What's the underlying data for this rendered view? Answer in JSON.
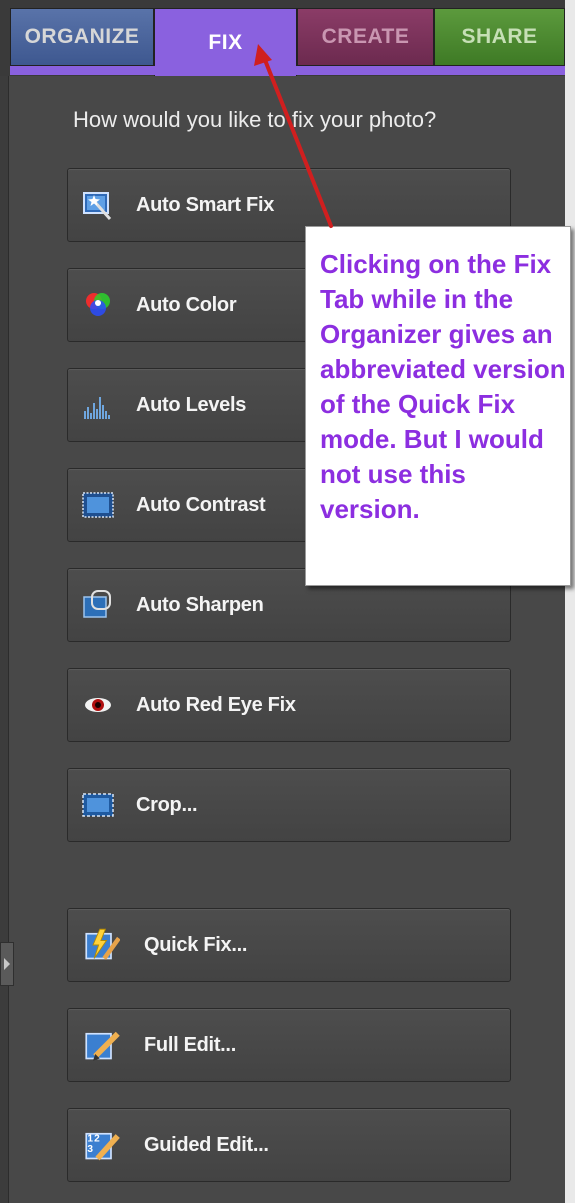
{
  "tabs": {
    "organize": "ORGANIZE",
    "fix": "FIX",
    "create": "CREATE",
    "share": "SHARE"
  },
  "prompt": "How would you like to fix your photo?",
  "buttons": {
    "auto_smart_fix": "Auto Smart Fix",
    "auto_color": "Auto Color",
    "auto_levels": "Auto Levels",
    "auto_contrast": "Auto Contrast",
    "auto_sharpen": "Auto Sharpen",
    "auto_red_eye_fix": "Auto Red Eye Fix",
    "crop": "Crop...",
    "quick_fix": "Quick Fix...",
    "full_edit": "Full Edit...",
    "guided_edit": "Guided Edit..."
  },
  "callout": {
    "text": "Clicking on the Fix Tab while in the Organizer gives an abbreviated version of the Quick Fix mode. But I would not use this version."
  },
  "colors": {
    "fix_tab": "#8a61df",
    "callout_text": "#8c2ee0",
    "arrow": "#d01f1f",
    "panel": "#484848"
  }
}
